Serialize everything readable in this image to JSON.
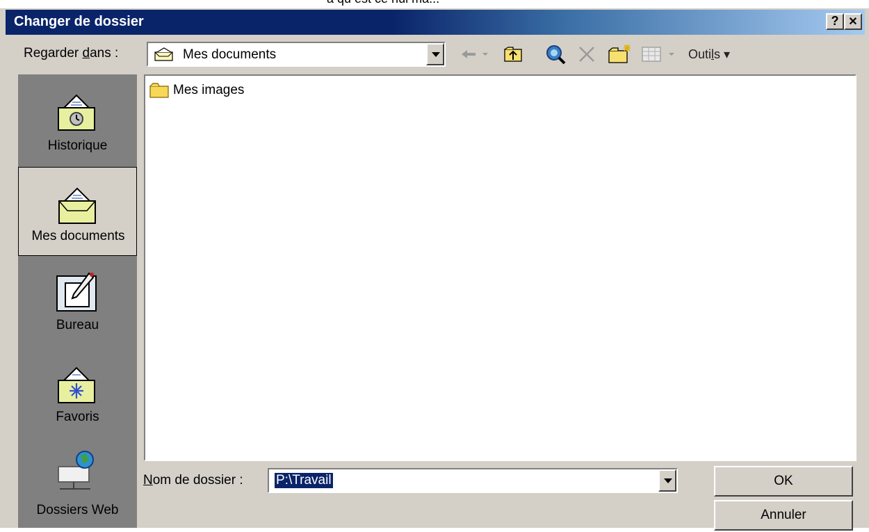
{
  "top_fragment": "a qu est ce nul ma...",
  "window": {
    "title": "Changer de dossier",
    "help_glyph": "?",
    "close_glyph": "✕"
  },
  "look_in": {
    "label_pre": "Regarder ",
    "label_u": "d",
    "label_post": "ans :",
    "value": "Mes documents",
    "icon": "my-documents-folder-icon"
  },
  "toolbar": {
    "tools_pre": "Outi",
    "tools_u": "l",
    "tools_post": "s ▾",
    "icons": [
      "back-arrow-icon",
      "up-folder-icon",
      "search-web-icon",
      "delete-icon",
      "new-folder-icon",
      "views-icon"
    ]
  },
  "places": [
    {
      "label": "Historique",
      "icon": "history-icon"
    },
    {
      "label": "Mes documents",
      "icon": "my-documents-icon",
      "selected": true
    },
    {
      "label": "Bureau",
      "icon": "desktop-icon"
    },
    {
      "label": "Favoris",
      "icon": "favorites-icon"
    },
    {
      "label": "Dossiers Web",
      "icon": "web-folders-icon"
    }
  ],
  "files": [
    {
      "name": "Mes images",
      "icon": "folder-icon"
    }
  ],
  "folder_name": {
    "label_u": "N",
    "label_post": "om de dossier :",
    "value": "P:\\Travail"
  },
  "buttons": {
    "ok": "OK",
    "cancel": "Annuler"
  },
  "colors": {
    "face": "#d4d0c8",
    "title_active": "#0a246a",
    "places_bg": "#808080",
    "selection": "#0a246a"
  }
}
